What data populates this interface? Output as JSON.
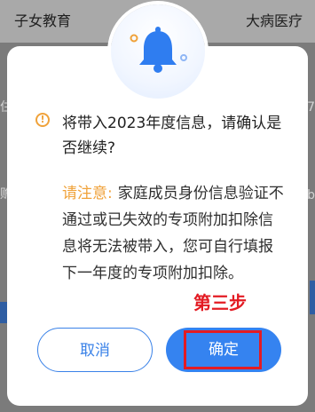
{
  "background": {
    "left_label": "子女教育",
    "right_label": "大病医疗",
    "edge_left_chars": [
      "住",
      "赡"
    ],
    "edge_right_chars": [
      "7",
      "b"
    ]
  },
  "dialog": {
    "message": "将带入2023年度信息，请确认是否继续?",
    "note_label": "请注意:",
    "note_text": "家庭成员身份信息验证不通过或已失效的专项附加扣除信息将无法被带入，您可自行填报下一年度的专项附加扣除。",
    "annotation": "第三步",
    "cancel_label": "取消",
    "confirm_label": "确定",
    "icons": [
      "bell-icon",
      "warning-icon"
    ]
  },
  "colors": {
    "accent": "#3583f0",
    "warning": "#f0a23a",
    "annotation": "#e31b23"
  }
}
